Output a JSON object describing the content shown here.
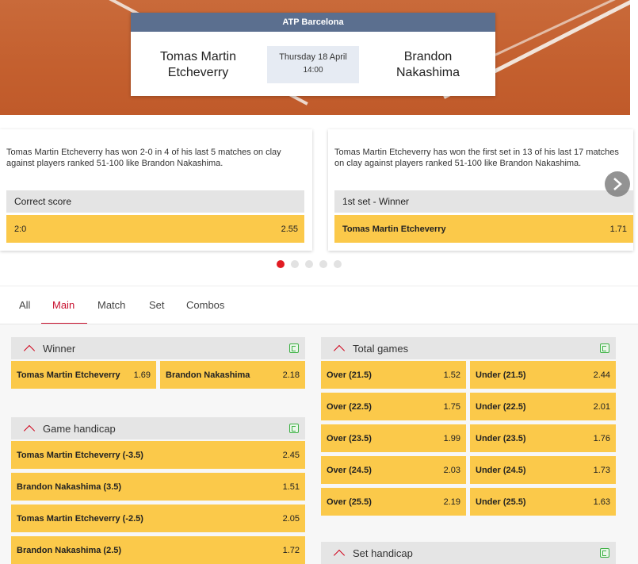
{
  "event": {
    "league": "ATP Barcelona",
    "player1_line1": "Tomas Martin",
    "player1_line2": "Etcheverry",
    "player2_line1": "Brandon",
    "player2_line2": "Nakashima",
    "date": "Thursday 18 April",
    "time": "14:00"
  },
  "stat_cards": [
    {
      "text_line1": "Tomas Martin Etcheverry has won 2-0 in 4 of his last 5 matches on clay",
      "text_line2": "against players ranked 51-100 like Brandon Nakashima.",
      "market": "Correct score",
      "selection": "2:0",
      "odds": "2.55"
    },
    {
      "text_line1": "Tomas Martin Etcheverry has won the first set in 13 of his last 17 matches",
      "text_line2": "on clay against players ranked 51-100 like Brandon Nakashima.",
      "market": "1st set - Winner",
      "selection": "Tomas Martin Etcheverry",
      "odds": "1.71"
    }
  ],
  "carousel": {
    "total_dots": 5,
    "active_dot": 1
  },
  "tabs": [
    {
      "label": "All"
    },
    {
      "label": "Main",
      "active": true
    },
    {
      "label": "Match"
    },
    {
      "label": "Set"
    },
    {
      "label": "Combos"
    }
  ],
  "markets": {
    "winner": {
      "title": "Winner",
      "selections": [
        {
          "name": "Tomas Martin Etcheverry",
          "odds": "1.69"
        },
        {
          "name": "Brandon Nakashima",
          "odds": "2.18"
        }
      ]
    },
    "game_handicap": {
      "title": "Game handicap",
      "selections": [
        {
          "name": "Tomas Martin Etcheverry (-3.5)",
          "odds": "2.45"
        },
        {
          "name": "Brandon Nakashima (3.5)",
          "odds": "1.51"
        },
        {
          "name": "Tomas Martin Etcheverry (-2.5)",
          "odds": "2.05"
        },
        {
          "name": "Brandon Nakashima (2.5)",
          "odds": "1.72"
        }
      ]
    },
    "total_games": {
      "title": "Total games",
      "rows": [
        {
          "over": "Over (21.5)",
          "over_odds": "1.52",
          "under": "Under (21.5)",
          "under_odds": "2.44"
        },
        {
          "over": "Over (22.5)",
          "over_odds": "1.75",
          "under": "Under (22.5)",
          "under_odds": "2.01"
        },
        {
          "over": "Over (23.5)",
          "over_odds": "1.99",
          "under": "Under (23.5)",
          "under_odds": "1.76"
        },
        {
          "over": "Over (24.5)",
          "over_odds": "2.03",
          "under": "Under (24.5)",
          "under_odds": "1.73"
        },
        {
          "over": "Over (25.5)",
          "over_odds": "2.19",
          "under": "Under (25.5)",
          "under_odds": "1.63"
        }
      ]
    },
    "set_handicap": {
      "title": "Set handicap"
    }
  },
  "colors": {
    "odds_button": "#fbc94a",
    "accent_red": "#c8102e",
    "league_header": "#5b6f8f",
    "clay": "#c4602f"
  },
  "icons": {
    "market_collapse": "chevron-up-icon",
    "stats": "stats-icon",
    "carousel_next": "chevron-right-icon"
  }
}
